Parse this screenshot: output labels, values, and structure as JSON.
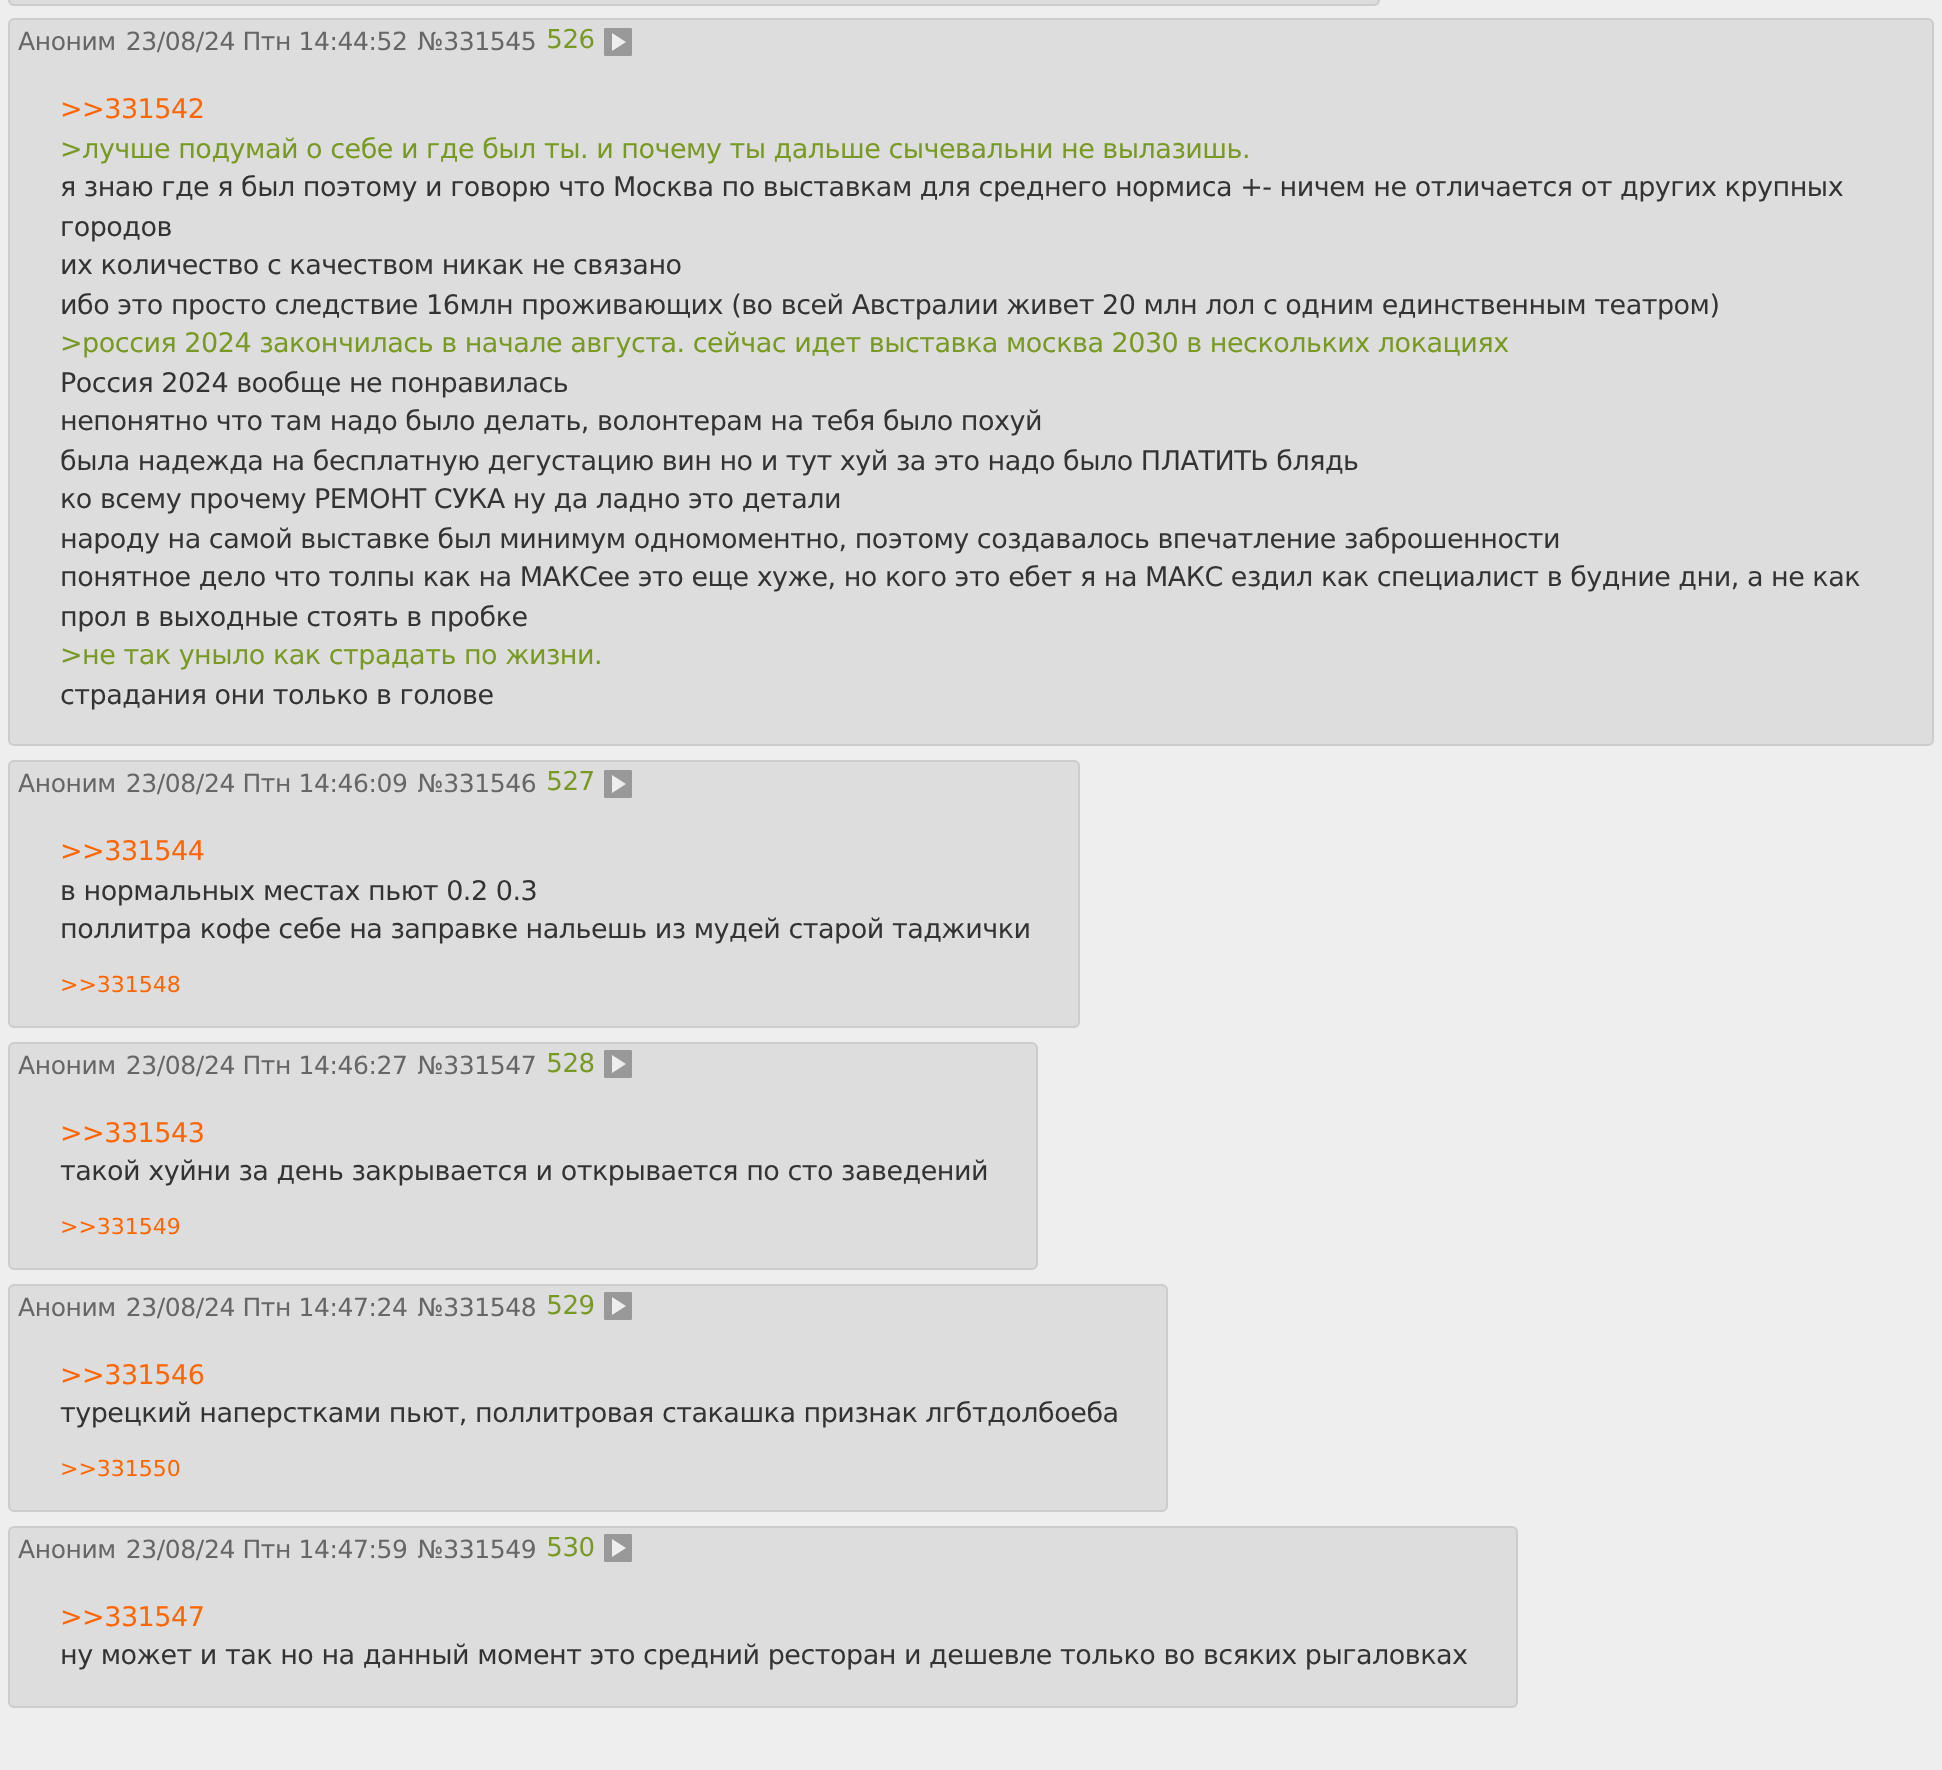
{
  "posts": [
    {
      "author": "Аноним",
      "date": "23/08/24 Птн 14:44:52",
      "number": "№331545",
      "index": "526",
      "lines": [
        {
          "kind": "reply",
          "text": ">>331542"
        },
        {
          "kind": "quote",
          "text": ">лучше подумай о себе и где был ты. и почему ты дальше сычевальни не вылазишь."
        },
        {
          "kind": "text",
          "text": "я знаю где я был поэтому и говорю что Москва по выставкам для среднего нормиса +- ничем не отличается от других крупных городов"
        },
        {
          "kind": "text",
          "text": "их количество с качеством никак не связано"
        },
        {
          "kind": "text",
          "text": "ибо это просто следствие 16млн проживающих (во всей Австралии живет 20 млн лол с одним единственным театром)"
        },
        {
          "kind": "quote",
          "text": ">россия 2024 закончилась в начале августа. сейчас идет выставка москва 2030 в нескольких локациях"
        },
        {
          "kind": "text",
          "text": "Россия 2024 вообще не понравилась"
        },
        {
          "kind": "text",
          "text": "непонятно что там надо было делать, волонтерам на тебя было похуй"
        },
        {
          "kind": "text",
          "text": "была надежда на бесплатную дегустацию вин но и тут хуй за это надо было ПЛАТИТЬ блядь"
        },
        {
          "kind": "text",
          "text": "ко всему прочему РЕМОНТ СУКА ну да ладно это детали"
        },
        {
          "kind": "text",
          "text": "народу на самой выставке был минимум одномоментно, поэтому создавалось впечатление заброшенности"
        },
        {
          "kind": "text",
          "text": "понятное дело что толпы как на МАКСее это еще хуже, но кого это ебет я на МАКС ездил как специалист в будние дни, а не как прол в выходные стоять в пробке"
        },
        {
          "kind": "quote",
          "text": ">не так уныло как страдать по жизни."
        },
        {
          "kind": "text",
          "text": "страдания они только в голове"
        }
      ]
    },
    {
      "author": "Аноним",
      "date": "23/08/24 Птн 14:46:09",
      "number": "№331546",
      "index": "527",
      "lines": [
        {
          "kind": "reply",
          "text": ">>331544"
        },
        {
          "kind": "text",
          "text": "в нормальных местах пьют 0.2 0.3"
        },
        {
          "kind": "text",
          "text": "поллитра кофе себе на заправке нальешь из мудей старой таджички"
        }
      ],
      "replies": [
        ">>331548"
      ]
    },
    {
      "author": "Аноним",
      "date": "23/08/24 Птн 14:46:27",
      "number": "№331547",
      "index": "528",
      "lines": [
        {
          "kind": "reply",
          "text": ">>331543"
        },
        {
          "kind": "text",
          "text": "такой хуйни за день закрывается и открывается по сто заведений"
        }
      ],
      "replies": [
        ">>331549"
      ]
    },
    {
      "author": "Аноним",
      "date": "23/08/24 Птн 14:47:24",
      "number": "№331548",
      "index": "529",
      "lines": [
        {
          "kind": "reply",
          "text": ">>331546"
        },
        {
          "kind": "text",
          "text": "турецкий наперстками пьют, поллитровая стакашка признак лгбтдолбоеба"
        }
      ],
      "replies": [
        ">>331550"
      ]
    },
    {
      "author": "Аноним",
      "date": "23/08/24 Птн 14:47:59",
      "number": "№331549",
      "index": "530",
      "lines": [
        {
          "kind": "reply",
          "text": ">>331547"
        },
        {
          "kind": "text",
          "text": "ну может и так но на данный момент это средний ресторан и дешевле только во всяких рыгаловках"
        }
      ]
    }
  ]
}
